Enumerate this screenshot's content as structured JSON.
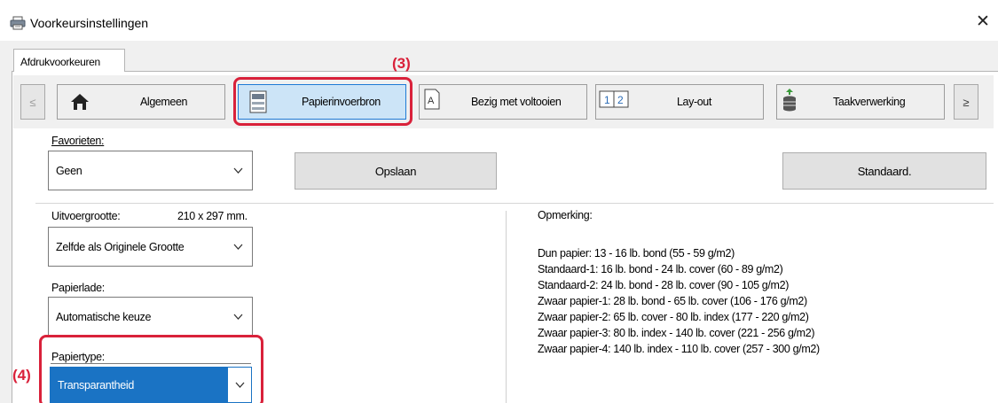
{
  "window": {
    "title": "Voorkeursinstellingen",
    "icon": "printer-icon",
    "close_glyph": "✕"
  },
  "outer_tab": {
    "label": "Afdrukvoorkeuren"
  },
  "tabs": {
    "prev": "≤",
    "next": "≥",
    "items": [
      {
        "label": "Algemeen",
        "icon": "home-icon"
      },
      {
        "label": "Papierinvoerbron",
        "icon": "paper-tray-icon",
        "active": true
      },
      {
        "label": "Bezig met voltooien",
        "icon": "finishing-icon"
      },
      {
        "label": "Lay-out",
        "icon": "layout-icon"
      },
      {
        "label": "Taakverwerking",
        "icon": "job-handling-icon"
      }
    ]
  },
  "favorites": {
    "label": "Favorieten:",
    "value": "Geen",
    "save_button": "Opslaan",
    "default_button": "Standaard."
  },
  "output_size": {
    "label": "Uitvoergrootte:",
    "dimension": "210 x 297 mm.",
    "value": "Zelfde als Originele Grootte"
  },
  "paper_tray": {
    "label": "Papierlade:",
    "value": "Automatische keuze"
  },
  "paper_type": {
    "label": "Papiertype:",
    "value": "Transparantheid"
  },
  "notes": {
    "title": "Opmerking:",
    "lines": [
      "Dun papier: 13 - 16 lb. bond (55 - 59 g/m2)",
      "Standaard-1: 16 lb. bond - 24 lb. cover (60 - 89 g/m2)",
      "Standaard-2: 24 lb. bond - 28 lb. cover (90 - 105 g/m2)",
      "Zwaar papier-1: 28 lb. bond - 65 lb. cover (106 - 176 g/m2)",
      "Zwaar papier-2: 65 lb. cover - 80 lb. index (177 - 220 g/m2)",
      "Zwaar papier-3: 80 lb. index - 140 lb. cover (221 - 256 g/m2)",
      "Zwaar papier-4: 140 lb. index - 110 lb. cover (257 - 300 g/m2)"
    ]
  },
  "callouts": {
    "step3": "(3)",
    "step4": "(4)"
  },
  "colors": {
    "callout": "#d9213a",
    "selection": "#1a73c4",
    "active_tab": "#cce4f7"
  }
}
